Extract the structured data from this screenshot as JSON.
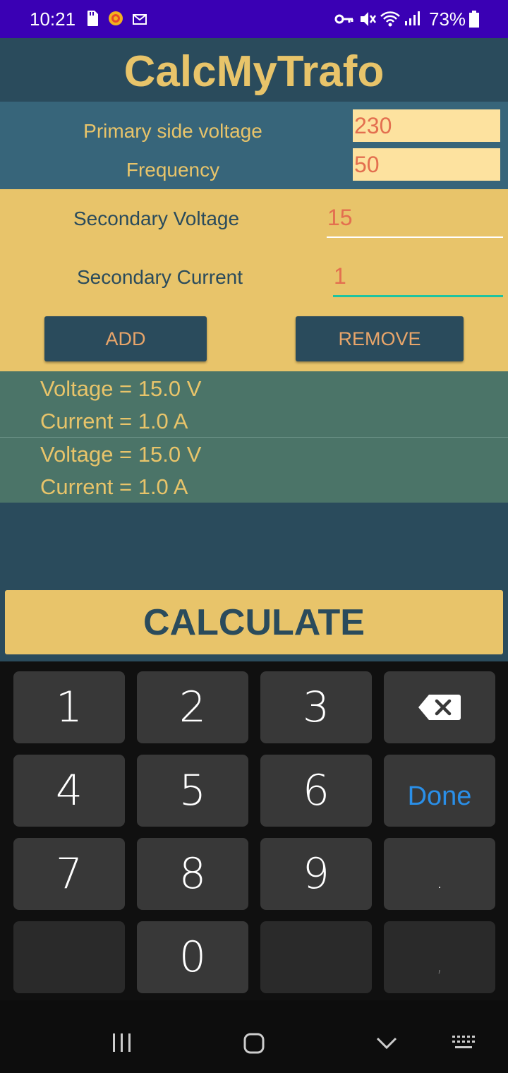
{
  "status_bar": {
    "time": "10:21",
    "battery_percent": "73%",
    "icons": [
      "sd-card-icon",
      "app-notification-icon",
      "mail-icon",
      "vpn-key-icon",
      "mute-icon",
      "wifi-icon",
      "signal-icon",
      "battery-icon"
    ]
  },
  "app": {
    "title": "CalcMyTrafo"
  },
  "primary": {
    "voltage_label": "Primary side voltage",
    "voltage_value": "230",
    "frequency_label": "Frequency",
    "frequency_value": "50"
  },
  "secondary": {
    "voltage_label": "Secondary Voltage",
    "voltage_value": "15",
    "current_label": "Secondary Current",
    "current_value": "1",
    "add_label": "ADD",
    "remove_label": "REMOVE"
  },
  "windings": [
    {
      "voltage": "Voltage = 15.0 V",
      "current": "Current = 1.0 A"
    },
    {
      "voltage": "Voltage = 15.0 V",
      "current": "Current = 1.0 A"
    }
  ],
  "calculate_label": "CALCULATE",
  "keyboard": {
    "keys": [
      "1",
      "2",
      "3",
      "4",
      "5",
      "6",
      "7",
      "8",
      "9",
      "0",
      ".",
      ","
    ],
    "done_label": "Done",
    "backspace_icon": "backspace-icon"
  },
  "colors": {
    "status_bar": "#3a00b4",
    "background": "#2a4b5c",
    "accent": "#e8c46a",
    "input_text": "#e36f4f",
    "list_bg": "#4b7468",
    "active_underline": "#1fc4a0"
  }
}
